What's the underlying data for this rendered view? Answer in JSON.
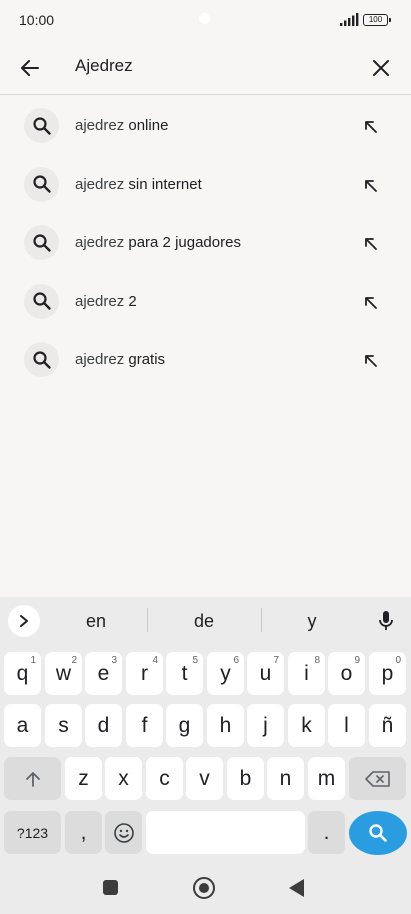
{
  "status": {
    "time": "10:00",
    "battery": "100"
  },
  "search": {
    "query": "Ajedrez",
    "back_icon": "arrow-left-icon",
    "clear_icon": "close-icon"
  },
  "suggestions": [
    {
      "typed": "ajedrez",
      "rest": " online"
    },
    {
      "typed": "ajedrez",
      "rest": " sin internet"
    },
    {
      "typed": "ajedrez",
      "rest": " para 2 jugadores"
    },
    {
      "typed": "ajedrez",
      "rest": " 2"
    },
    {
      "typed": "ajedrez",
      "rest": " gratis"
    }
  ],
  "keyboard": {
    "word_suggestions": [
      "en",
      "de",
      "y"
    ],
    "row1": [
      {
        "label": "q",
        "hint": "1"
      },
      {
        "label": "w",
        "hint": "2"
      },
      {
        "label": "e",
        "hint": "3"
      },
      {
        "label": "r",
        "hint": "4"
      },
      {
        "label": "t",
        "hint": "5"
      },
      {
        "label": "y",
        "hint": "6"
      },
      {
        "label": "u",
        "hint": "7"
      },
      {
        "label": "i",
        "hint": "8"
      },
      {
        "label": "o",
        "hint": "9"
      },
      {
        "label": "p",
        "hint": "0"
      }
    ],
    "row2": [
      "a",
      "s",
      "d",
      "f",
      "g",
      "h",
      "j",
      "k",
      "l",
      "ñ"
    ],
    "row3": [
      "z",
      "x",
      "c",
      "v",
      "b",
      "n",
      "m"
    ],
    "symbols_label": "?123",
    "comma": ",",
    "period": ".",
    "accent_color": "#2a9de0"
  }
}
